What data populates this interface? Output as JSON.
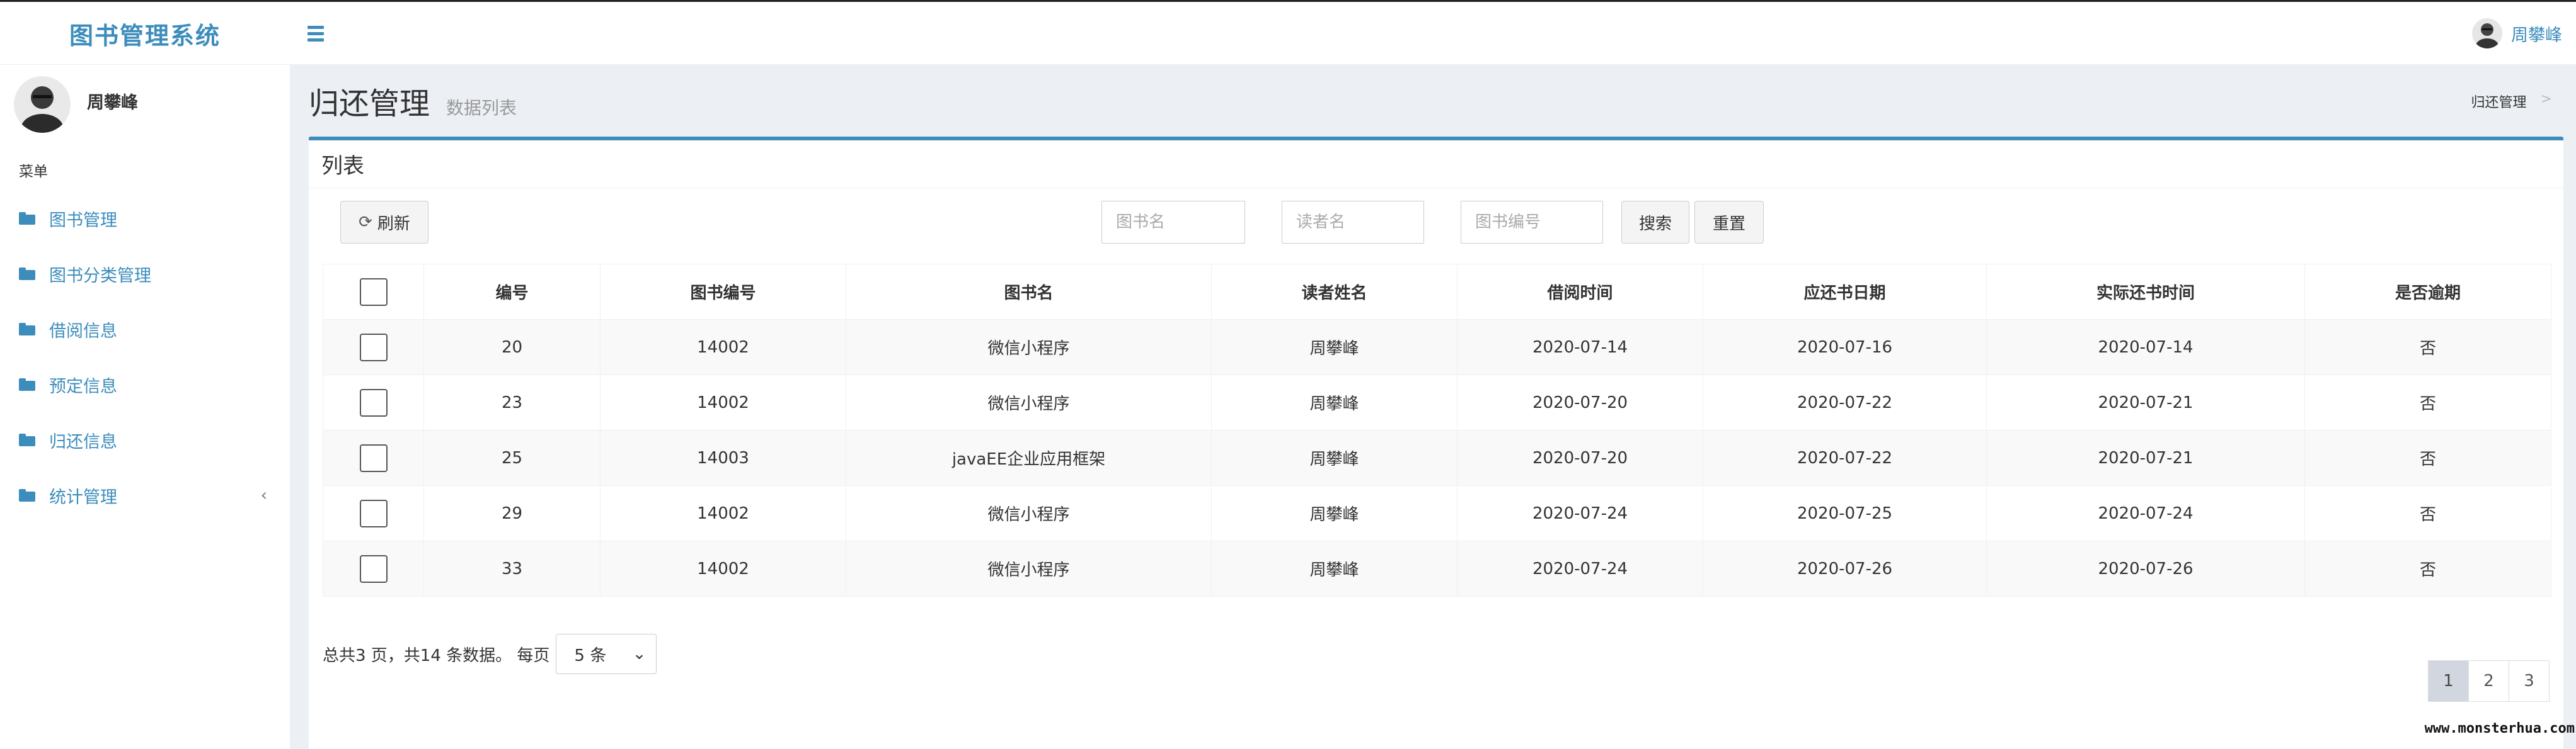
{
  "header": {
    "app_title": "图书管理系统",
    "user_name": "周攀峰"
  },
  "sidebar": {
    "user_name": "周攀峰",
    "menu_header": "菜单",
    "items": [
      {
        "label": "图书管理",
        "icon": "folder-icon"
      },
      {
        "label": "图书分类管理",
        "icon": "folder-icon"
      },
      {
        "label": "借阅信息",
        "icon": "folder-icon"
      },
      {
        "label": "预定信息",
        "icon": "folder-icon"
      },
      {
        "label": "归还信息",
        "icon": "folder-icon"
      },
      {
        "label": "统计管理",
        "icon": "folder-icon",
        "chevron": "‹"
      }
    ]
  },
  "page": {
    "title": "归还管理",
    "subtitle": "数据列表",
    "breadcrumb": "归还管理",
    "breadcrumb_sep": ">"
  },
  "box": {
    "title": "列表",
    "refresh_label": "刷新",
    "search": {
      "book_name_placeholder": "图书名",
      "reader_name_placeholder": "读者名",
      "book_code_placeholder": "图书编号",
      "search_label": "搜索",
      "reset_label": "重置"
    }
  },
  "table": {
    "columns": [
      "编号",
      "图书编号",
      "图书名",
      "读者姓名",
      "借阅时间",
      "应还书日期",
      "实际还书时间",
      "是否逾期"
    ],
    "rows": [
      {
        "id": "20",
        "book_code": "14002",
        "book_name": "微信小程序",
        "reader": "周攀峰",
        "borrow": "2020-07-14",
        "due": "2020-07-16",
        "returned": "2020-07-14",
        "overdue": "否"
      },
      {
        "id": "23",
        "book_code": "14002",
        "book_name": "微信小程序",
        "reader": "周攀峰",
        "borrow": "2020-07-20",
        "due": "2020-07-22",
        "returned": "2020-07-21",
        "overdue": "否"
      },
      {
        "id": "25",
        "book_code": "14003",
        "book_name": "javaEE企业应用框架",
        "reader": "周攀峰",
        "borrow": "2020-07-20",
        "due": "2020-07-22",
        "returned": "2020-07-21",
        "overdue": "否"
      },
      {
        "id": "29",
        "book_code": "14002",
        "book_name": "微信小程序",
        "reader": "周攀峰",
        "borrow": "2020-07-24",
        "due": "2020-07-25",
        "returned": "2020-07-24",
        "overdue": "否"
      },
      {
        "id": "33",
        "book_code": "14002",
        "book_name": "微信小程序",
        "reader": "周攀峰",
        "borrow": "2020-07-24",
        "due": "2020-07-26",
        "returned": "2020-07-26",
        "overdue": "否"
      }
    ]
  },
  "pager": {
    "summary": "总共3 页，共14 条数据。 每页",
    "page_size": "5 条",
    "pages": [
      "1",
      "2",
      "3"
    ],
    "active_page": "1"
  },
  "watermark": "www.monsterhua.com",
  "colors": {
    "accent": "#3c8dbc",
    "content_bg": "#ecf0f5"
  }
}
